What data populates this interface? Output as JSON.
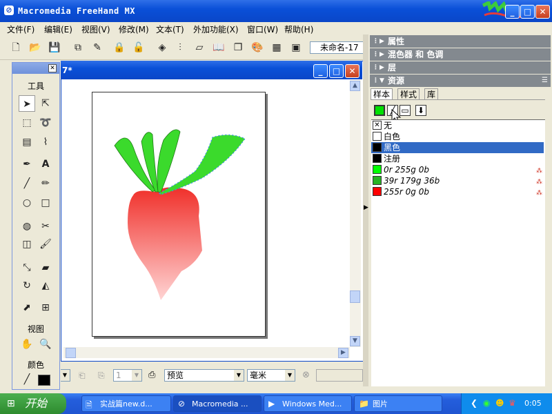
{
  "app": {
    "title": "Macromedia FreeHand MX",
    "icon": "⊘"
  },
  "window_controls": {
    "minimize": "_",
    "maximize": "□",
    "close": "✕"
  },
  "menu": [
    "文件(F)",
    "编辑(E)",
    "视图(V)",
    "修改(M)",
    "文本(T)",
    "外加功能(X)",
    "窗口(W)",
    "帮助(H)"
  ],
  "toolbar": {
    "doc_select": "未命名-17"
  },
  "document": {
    "title": "7*"
  },
  "toolbox": {
    "title": "工具",
    "view_label": "视图",
    "color_label": "颜色"
  },
  "statusbar": {
    "page_num": "1",
    "view_mode": "预览",
    "units": "毫米"
  },
  "panels": {
    "properties": "属性",
    "mixer": "混色器 和 色调",
    "layers": "层",
    "assets": "资源"
  },
  "assets_tabs": [
    "样本",
    "样式",
    "库"
  ],
  "swatches": [
    {
      "label": "无",
      "chip": "none",
      "italic": false,
      "selected": false,
      "mark": false
    },
    {
      "label": "白色",
      "chip": "#FFFFFF",
      "italic": false,
      "selected": false,
      "mark": false
    },
    {
      "label": "黑色",
      "chip": "#000000",
      "italic": false,
      "selected": true,
      "mark": false
    },
    {
      "label": "注册",
      "chip": "#000000",
      "italic": false,
      "selected": false,
      "mark": false
    },
    {
      "label": "0r 255g 0b",
      "chip": "#00FF00",
      "italic": true,
      "selected": false,
      "mark": true
    },
    {
      "label": "39r 179g 36b",
      "chip": "#27B324",
      "italic": true,
      "selected": false,
      "mark": true
    },
    {
      "label": "255r 0g 0b",
      "chip": "#FF0000",
      "italic": true,
      "selected": false,
      "mark": true
    }
  ],
  "taskbar": {
    "start": "开始",
    "items": [
      "实战篇new.d...",
      "Macromedia ...",
      "Windows Med...",
      "图片"
    ],
    "clock": "0:05"
  },
  "colors": {
    "selection": "#316AC5",
    "leaf_green": "#3BDA2C",
    "radish_top": "#F0302A",
    "radish_bottom": "#FFD4D4"
  }
}
